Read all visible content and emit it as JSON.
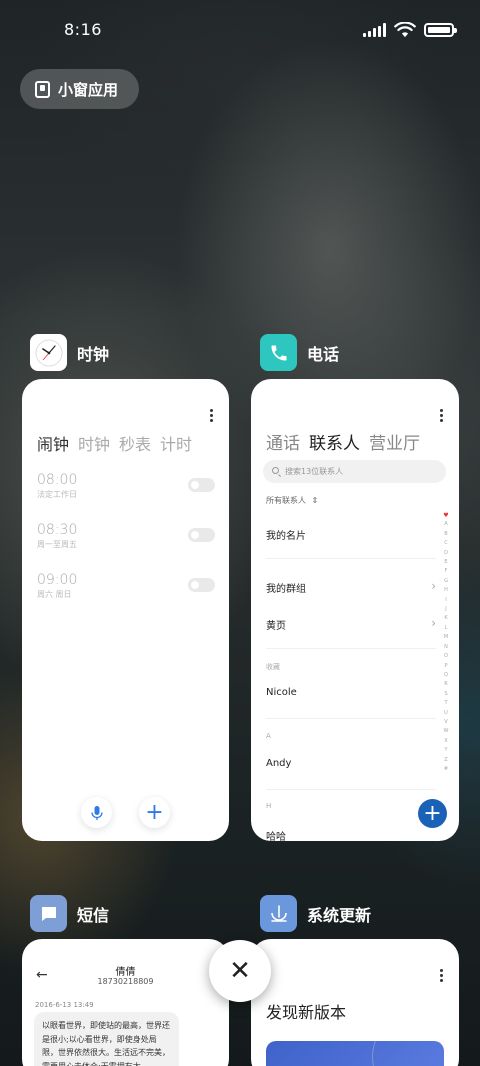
{
  "status_bar": {
    "time": "8:16"
  },
  "pill": {
    "label": "小窗应用"
  },
  "apps": {
    "clock": {
      "name": "时钟",
      "tabs": [
        "闹钟",
        "时钟",
        "秒表",
        "计时"
      ],
      "alarms": [
        {
          "time": "08:00",
          "desc": "法定工作日"
        },
        {
          "time": "08:30",
          "desc": "周一至周五"
        },
        {
          "time": "09:00",
          "desc": "周六 周日"
        }
      ]
    },
    "phone": {
      "name": "电话",
      "tabs": [
        "通话",
        "联系人",
        "营业厅"
      ],
      "search_placeholder": "搜索13位联系人",
      "all_contacts": "所有联系人",
      "my_card": "我的名片",
      "my_groups": "我的群组",
      "yellow_pages": "黄页",
      "section_favorites": "收藏",
      "contact_nicole": "Nicole",
      "section_a": "A",
      "contact_andy": "Andy",
      "section_h": "H",
      "contact_haha": "哈哈",
      "index_letters": [
        "A",
        "B",
        "C",
        "D",
        "E",
        "F",
        "G",
        "H",
        "I",
        "J",
        "K",
        "L",
        "M",
        "N",
        "O",
        "P",
        "Q",
        "R",
        "S",
        "T",
        "U",
        "V",
        "W",
        "X",
        "Y",
        "Z",
        "#"
      ]
    },
    "sms": {
      "name": "短信",
      "contact_name": "倩倩",
      "contact_number": "18730218809",
      "date": "2016-6-13 13:49",
      "message": "以眼看世界，即使站的最高，世界还是很小;以心看世界，即使身处局限，世界依然很大。生活远不完美，需要用心去体会;无需拥有太"
    },
    "update": {
      "name": "系统更新",
      "title": "发现新版本"
    }
  },
  "colors": {
    "phone_icon": "#2ec7c0",
    "sms_icon": "#7e9fd6",
    "update_icon": "#6b97dd",
    "accent_blue": "#1a62b8"
  }
}
